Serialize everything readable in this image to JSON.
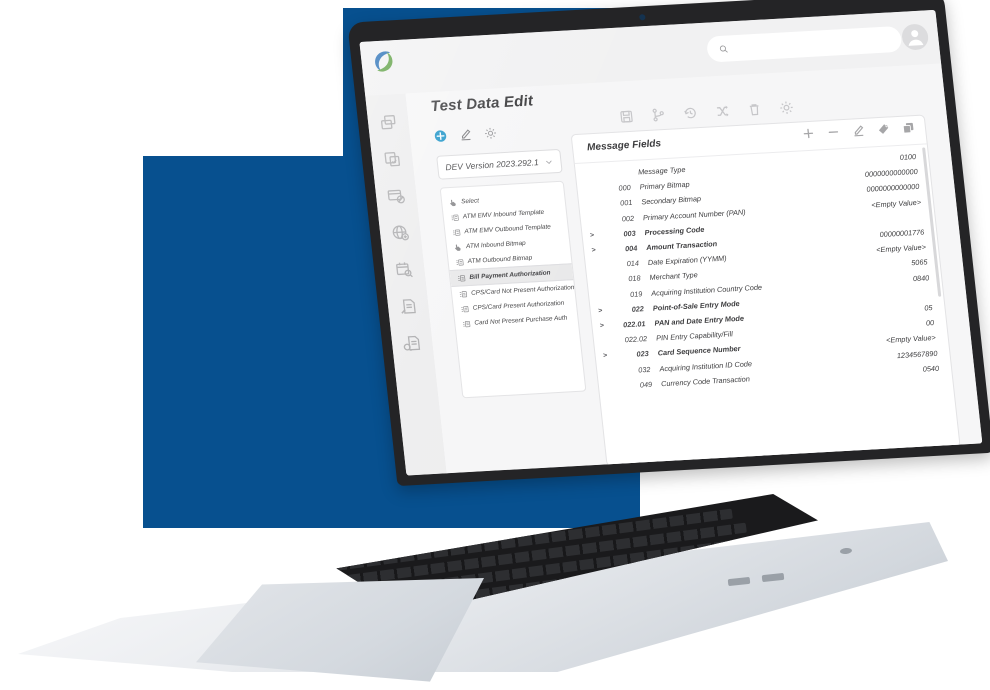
{
  "brand": {
    "logo_name": "company-swirl-logo",
    "logo_blue": "#1f6ab4",
    "logo_green": "#5a9e3f",
    "background_blue": "#07508F",
    "accent_blue": "#2196c9"
  },
  "header": {
    "search": {
      "value": "",
      "placeholder": ""
    },
    "avatar_name": "user-avatar"
  },
  "rail": {
    "items": [
      {
        "icon": "copy-windows-icon"
      },
      {
        "icon": "checklist-document-icon"
      },
      {
        "icon": "card-block-icon"
      },
      {
        "icon": "globe-network-icon"
      },
      {
        "icon": "calendar-search-icon"
      },
      {
        "icon": "document-hand-icon"
      },
      {
        "icon": "document-search-icon"
      }
    ]
  },
  "page": {
    "title": "Test Data Edit",
    "title_actions": [
      {
        "icon": "add-circle-icon",
        "label": "Add"
      },
      {
        "icon": "pencil-edit-icon",
        "label": "Edit"
      },
      {
        "icon": "gear-settings-icon",
        "label": "Settings"
      }
    ],
    "toolbar": [
      {
        "icon": "save-disk-icon",
        "label": "Save"
      },
      {
        "icon": "branch-merge-icon",
        "label": "Branch"
      },
      {
        "icon": "history-clock-icon",
        "label": "History"
      },
      {
        "icon": "shuffle-swap-icon",
        "label": "Swap"
      },
      {
        "icon": "trash-delete-icon",
        "label": "Delete"
      },
      {
        "icon": "gear-settings-icon",
        "label": "Settings"
      }
    ]
  },
  "version_select": {
    "value": "DEV Version 2023.292.1",
    "chevron_icon": "chevron-down-icon"
  },
  "template_list": {
    "items": [
      {
        "label": "Select",
        "icon": "select-pointer-icon",
        "selected": false
      },
      {
        "label": "ATM EMV Inbound Template",
        "icon": "list-lines-icon",
        "selected": false
      },
      {
        "label": "ATM EMV Outbound Template",
        "icon": "list-lines-icon",
        "selected": false
      },
      {
        "label": "ATM Inbound Bitmap",
        "icon": "select-pointer-icon",
        "selected": false
      },
      {
        "label": "ATM Outbound Bitmap",
        "icon": "list-lines-icon",
        "selected": false
      },
      {
        "label": "Bill Payment Authorization",
        "icon": "list-lines-icon",
        "selected": true
      },
      {
        "label": "CPS/Card Not Present Authorization",
        "icon": "list-lines-icon",
        "selected": false
      },
      {
        "label": "CPS/Card Present Authorization",
        "icon": "list-lines-icon",
        "selected": false
      },
      {
        "label": "Card Not Present Purchase Auth",
        "icon": "list-lines-icon",
        "selected": false
      }
    ]
  },
  "message_fields": {
    "title": "Message Fields",
    "tools": [
      {
        "icon": "plus-add-icon",
        "label": "+"
      },
      {
        "icon": "minus-remove-icon",
        "label": "−"
      },
      {
        "icon": "pencil-edit-icon",
        "label": "Edit"
      },
      {
        "icon": "tag-label-icon",
        "label": "Tag"
      },
      {
        "icon": "copy-duplicate-icon",
        "label": "Copy"
      }
    ],
    "rows": [
      {
        "chevron": "",
        "code": "",
        "name": "Message Type",
        "value": "0100",
        "bold": false
      },
      {
        "chevron": "",
        "code": "000",
        "name": "Primary Bitmap",
        "value": "0000000000000",
        "bold": false
      },
      {
        "chevron": "",
        "code": "001",
        "name": "Secondary Bitmap",
        "value": "0000000000000",
        "bold": false
      },
      {
        "chevron": "",
        "code": "002",
        "name": "Primary Account Number (PAN)",
        "value": "<Empty Value>",
        "bold": false
      },
      {
        "chevron": ">",
        "code": "003",
        "name": "Processing Code",
        "value": "",
        "bold": true
      },
      {
        "chevron": ">",
        "code": "004",
        "name": "Amount Transaction",
        "value": "00000001776",
        "bold": true
      },
      {
        "chevron": "",
        "code": "014",
        "name": "Date Expiration (YYMM)",
        "value": "<Empty Value>",
        "bold": false
      },
      {
        "chevron": "",
        "code": "018",
        "name": "Merchant Type",
        "value": "5065",
        "bold": false
      },
      {
        "chevron": "",
        "code": "019",
        "name": "Acquiring Institution Country Code",
        "value": "0840",
        "bold": false
      },
      {
        "chevron": ">",
        "code": "022",
        "name": "Point-of-Sale Entry Mode",
        "value": "",
        "bold": true
      },
      {
        "chevron": ">",
        "code": "022.01",
        "name": "PAN and Date Entry Mode",
        "value": "05",
        "bold": true
      },
      {
        "chevron": "",
        "code": "022.02",
        "name": "PIN Entry Capability/Fill",
        "value": "00",
        "bold": false
      },
      {
        "chevron": ">",
        "code": "023",
        "name": "Card Sequence Number",
        "value": "<Empty Value>",
        "bold": true
      },
      {
        "chevron": "",
        "code": "032",
        "name": "Acquiring Institution ID Code",
        "value": "1234567890",
        "bold": false
      },
      {
        "chevron": "",
        "code": "049",
        "name": "Currency Code Transaction",
        "value": "0540",
        "bold": false
      }
    ]
  }
}
